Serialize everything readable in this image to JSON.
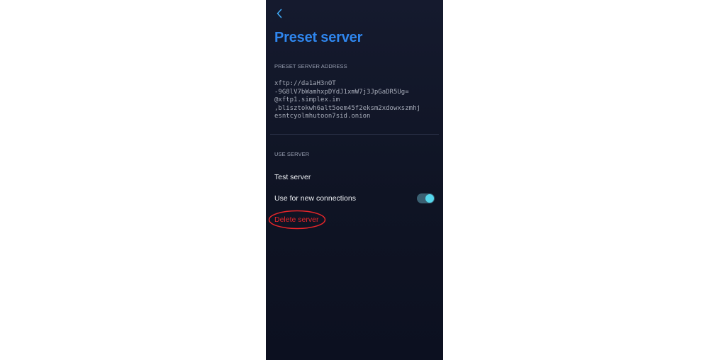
{
  "header": {
    "back_icon": "chevron-left-icon",
    "title": "Preset server"
  },
  "address_section": {
    "label": "PRESET SERVER ADDRESS",
    "lines": [
      "xftp://da1aH3nOT",
      "-9G8lV7bWamhxpDYdJ1xmW7j3JpGaDR5Ug=",
      "@xftp1.simplex.im",
      ",blisztokwh6alt5oem45f2eksm2xdowxszmhj",
      "esntcyolmhutoon7sid.onion"
    ]
  },
  "use_section": {
    "label": "USE SERVER",
    "test_server": "Test server",
    "use_for_new_connections": "Use for new connections",
    "use_for_new_connections_enabled": true,
    "delete_server": "Delete server"
  },
  "colors": {
    "title": "#2f86ee",
    "delete": "#e8262a",
    "toggle_knob": "#55d7ec",
    "annotation": "#e8262a"
  }
}
